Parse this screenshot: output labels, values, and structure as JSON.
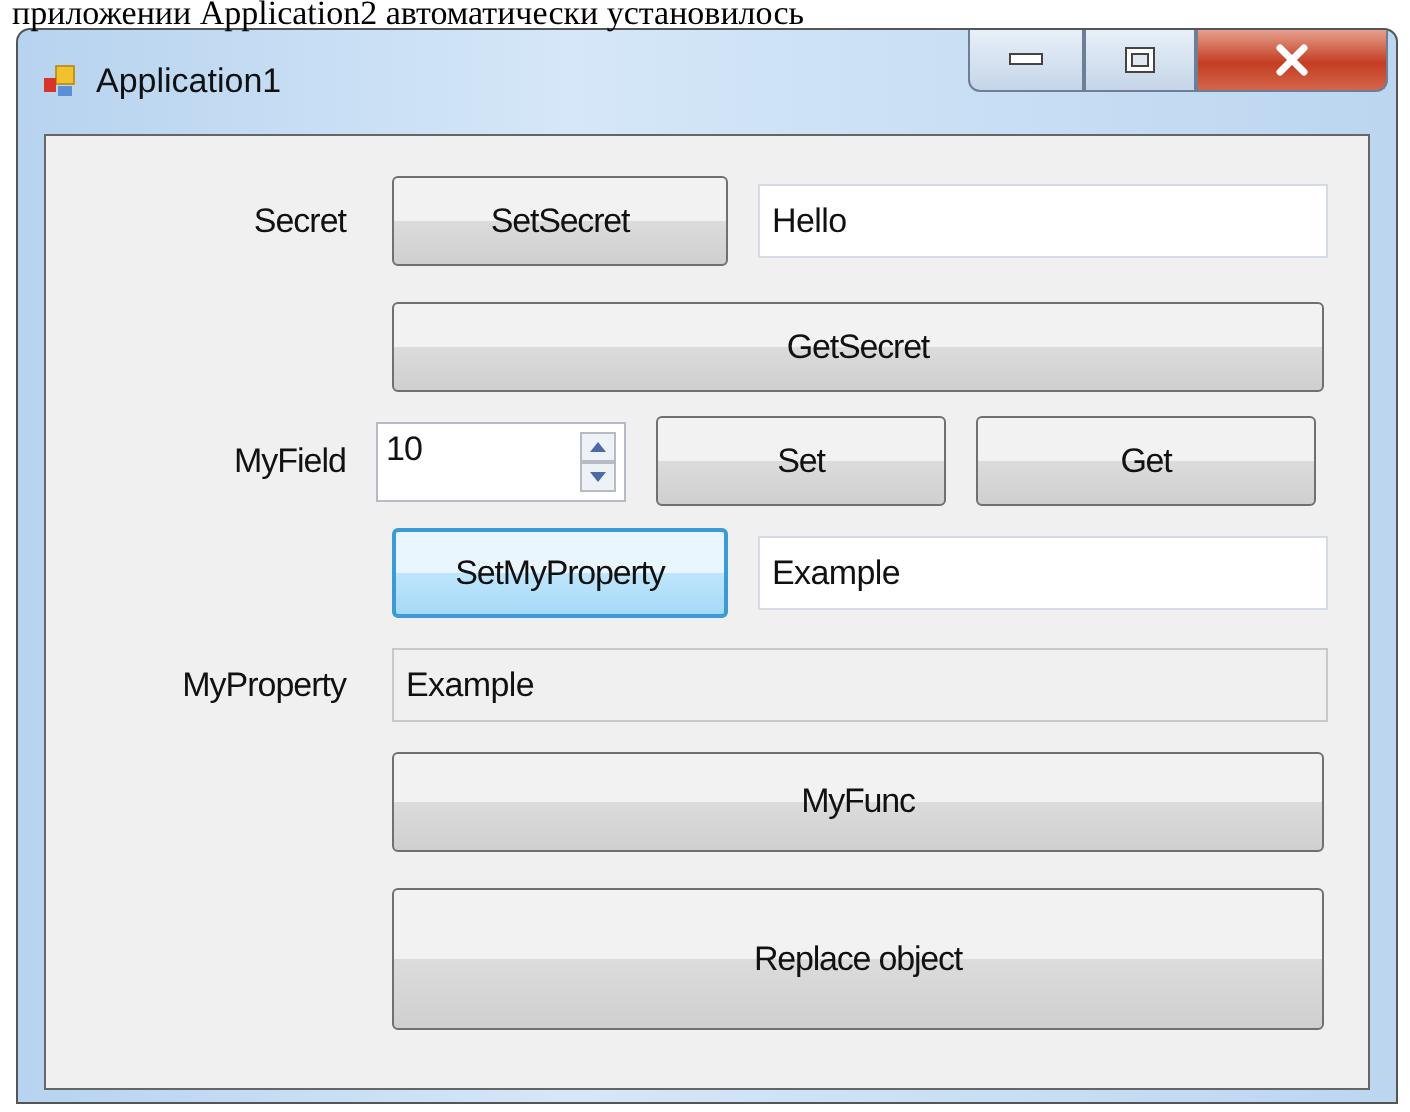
{
  "caption": "приложении Application2 автоматически установилось",
  "window": {
    "title": "Application1",
    "buttons": [
      {
        "kind": "minimize"
      },
      {
        "kind": "maximize"
      },
      {
        "kind": "close"
      }
    ]
  },
  "secret": {
    "label": "Secret",
    "button": {
      "label": "SetSecret",
      "focused": false
    },
    "field": {
      "value": "Hello"
    }
  },
  "get_secret": {
    "label": "GetSecret",
    "focused": false
  },
  "my_field": {
    "label": "MyField",
    "spinner": {
      "value": "10"
    },
    "set": {
      "label": "Set",
      "focused": false
    },
    "get": {
      "label": "Get",
      "focused": false
    }
  },
  "set_property": {
    "button": {
      "label": "SetMyProperty",
      "focused": true
    },
    "field": {
      "value": "Example"
    }
  },
  "my_property": {
    "label": "MyProperty",
    "field": {
      "value": "Example",
      "readonly": true
    }
  },
  "my_func": {
    "label": "MyFunc",
    "focused": false
  },
  "replace": {
    "label": "Replace object",
    "focused": false
  }
}
